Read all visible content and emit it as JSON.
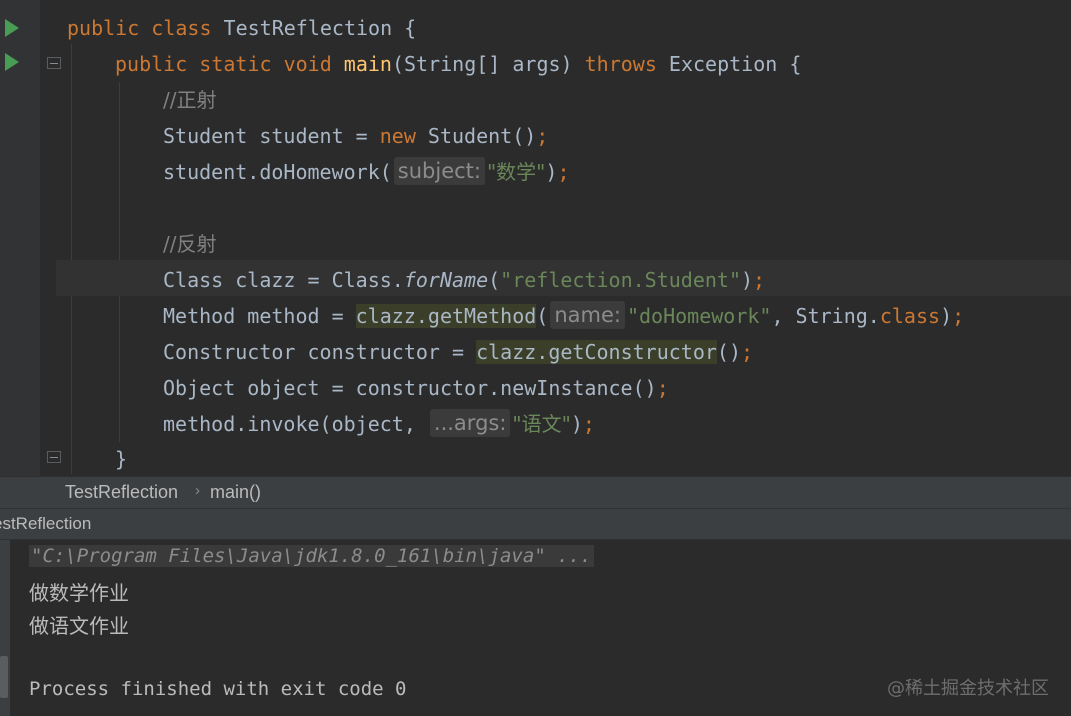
{
  "editor": {
    "line1": {
      "kw": "public class",
      "name": " TestReflection {"
    },
    "line2": {
      "kw1": "public static void",
      "fn": "main",
      "params": "(String[] args) ",
      "kw2": "throws",
      "rest": " Exception {"
    },
    "line3": {
      "comment": "//正射"
    },
    "line4": {
      "a": "Student student = ",
      "kw": "new",
      "b": " Student()",
      "semi": ";"
    },
    "line5": {
      "a": "student.doHomework(",
      "hint": "subject:",
      "str": "\"数学\"",
      "b": ")",
      "semi": ";"
    },
    "line6": {
      "comment": "//反射"
    },
    "line7": {
      "a": "Class clazz = Class.",
      "it": "forName",
      "b": "(",
      "str": "\"reflection.Student\"",
      "c": ")",
      "semi": ";"
    },
    "line8": {
      "a": "Method method = ",
      "hl": "clazz.getMethod",
      "b": "(",
      "hint": "name:",
      "str": "\"doHomework\"",
      "c": ", String.",
      "kw": "class",
      "d": ")",
      "semi": ";"
    },
    "line9": {
      "a": "Constructor constructor = ",
      "hl": "clazz.getConstructor",
      "b": "()",
      "semi": ";"
    },
    "line10": {
      "a": "Object object = constructor.newInstance()",
      "semi": ";"
    },
    "line11": {
      "a": "method.invoke(object, ",
      "hint": "...args:",
      "str": "\"语文\"",
      "b": ")",
      "semi": ";"
    },
    "line12": {
      "brace": "}"
    }
  },
  "breadcrumb": {
    "class": "TestReflection",
    "separator": "›",
    "method": "main()"
  },
  "run": {
    "tab_label": "estReflection",
    "command": "\"C:\\Program Files\\Java\\jdk1.8.0_161\\bin\\java\" ...",
    "output1": "做数学作业",
    "output2": "做语文作业",
    "exit": "Process finished with exit code 0"
  },
  "watermark": "@稀土掘金技术社区",
  "icons": {
    "run": "run-gutter-icon",
    "fold": "fold-marker-icon"
  },
  "colors": {
    "background": "#2b2b2b",
    "keyword": "#cc7832",
    "string": "#6a8759",
    "method": "#ffc66d",
    "comment": "#808080",
    "text": "#a9b7c6"
  }
}
